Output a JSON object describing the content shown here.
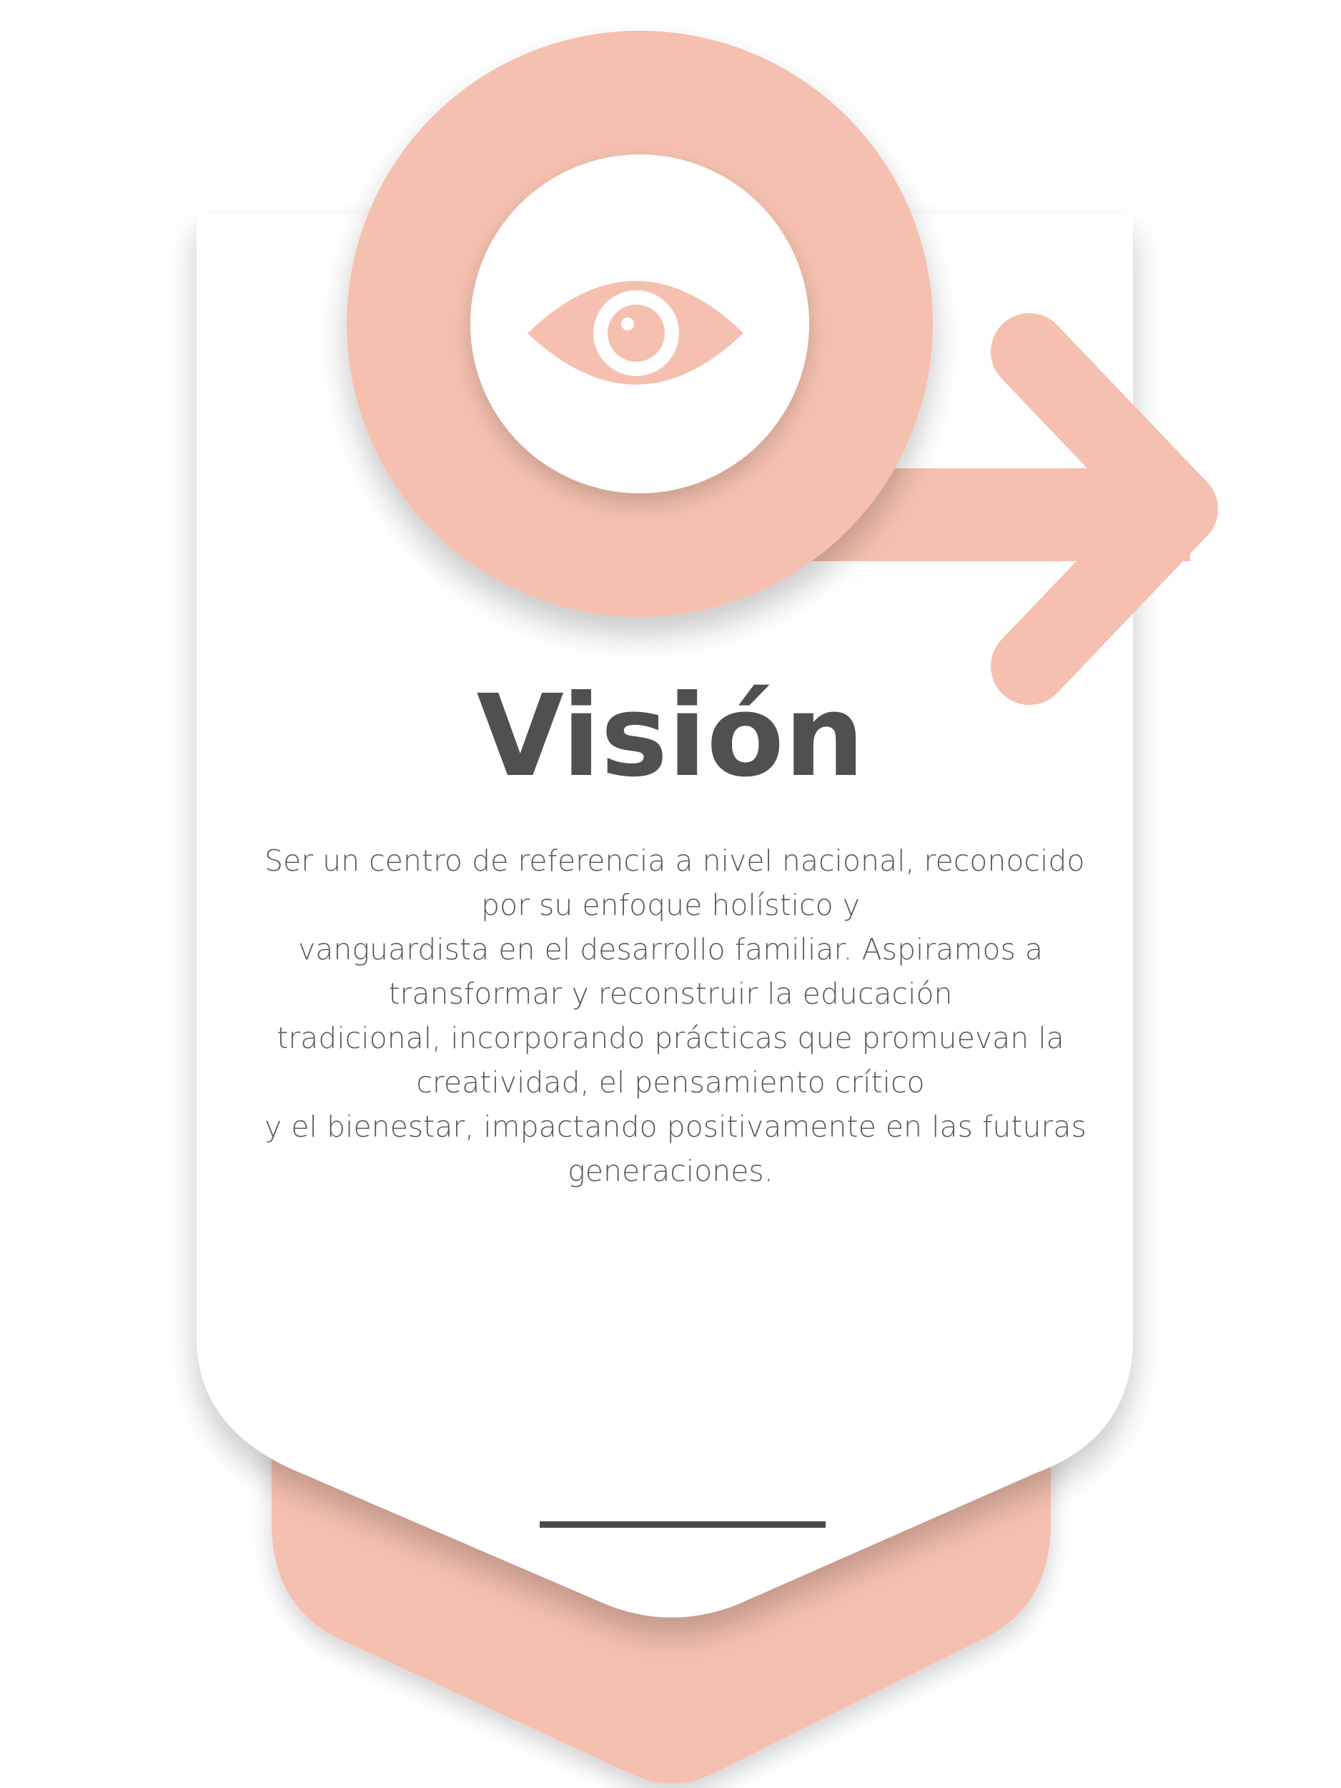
{
  "title": "Visión",
  "description_lines": [
    "Ser un centro de referencia a nivel nacional, reconocido",
    "por su enfoque holístico y",
    "vanguardista en el desarrollo familiar. Aspiramos a",
    "transformar y reconstruir la educación",
    "tradicional, incorporando prácticas que promuevan la",
    "creatividad, el pensamiento crítico",
    "y el bienestar, impactando positivamente en las futuras",
    "generaciones."
  ],
  "icon": "eye-icon",
  "colors": {
    "accent": "#F5C0AF",
    "card": "#FFFFFF",
    "text": "#505050",
    "divider": "#4A4A4A"
  }
}
